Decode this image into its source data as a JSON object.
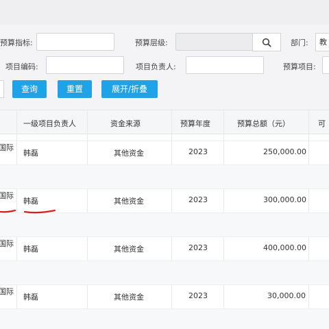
{
  "filters": {
    "budget_indicator_label": "预算指标:",
    "budget_level_label": "预算层级:",
    "department_label": "部门:",
    "department_value": "教",
    "project_code_label": "项目编码:",
    "project_owner_label": "项目负责人:",
    "budget_project_label": "预算项目:"
  },
  "buttons": {
    "query": "查询",
    "reset": "重置",
    "expand_collapse": "展开/折叠"
  },
  "table": {
    "headers": [
      "一级项目负责人",
      "资金来源",
      "预算年度",
      "预算总额（元）",
      "可"
    ],
    "rows": [
      {
        "project": "国际",
        "owner": "韩磊",
        "source": "其他资金",
        "year": "2023",
        "amount": "250,000.00"
      },
      {
        "project": "国际",
        "owner": "韩磊",
        "source": "其他资金",
        "year": "2023",
        "amount": "300,000.00"
      },
      {
        "project": "国际",
        "owner": "韩磊",
        "source": "其他资金",
        "year": "2023",
        "amount": "400,000.00"
      },
      {
        "project": "国际",
        "owner": "韩磊",
        "source": "其他资金",
        "year": "2023",
        "amount": "30,000.00"
      }
    ]
  },
  "annotation_color": "#d81e1e",
  "accent_color": "#1fa3e8"
}
